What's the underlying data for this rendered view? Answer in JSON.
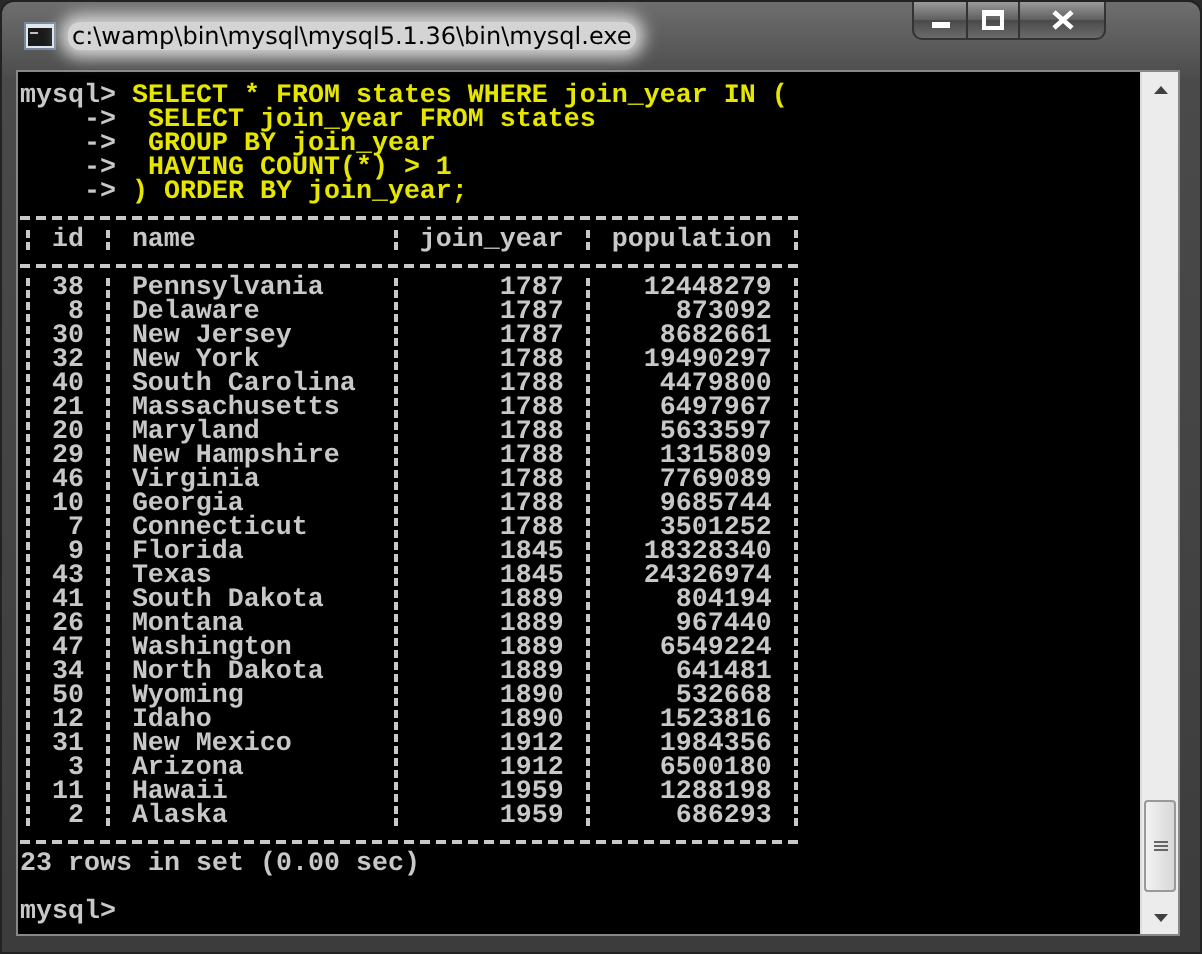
{
  "window": {
    "title": "c:\\wamp\\bin\\mysql\\mysql5.1.36\\bin\\mysql.exe"
  },
  "console": {
    "query": [
      {
        "prompt": "mysql>",
        "input": "SELECT * FROM states WHERE join_year IN ("
      },
      {
        "prompt": "->",
        "input": " SELECT join_year FROM states"
      },
      {
        "prompt": "->",
        "input": " GROUP BY join_year"
      },
      {
        "prompt": "->",
        "input": " HAVING COUNT(*) > 1"
      },
      {
        "prompt": "->",
        "input": ") ORDER BY join_year;"
      }
    ],
    "table": {
      "columns": [
        "id",
        "name",
        "join_year",
        "population"
      ],
      "rows": [
        [
          "38",
          "Pennsylvania",
          "1787",
          "12448279"
        ],
        [
          "8",
          "Delaware",
          "1787",
          "873092"
        ],
        [
          "30",
          "New Jersey",
          "1787",
          "8682661"
        ],
        [
          "32",
          "New York",
          "1788",
          "19490297"
        ],
        [
          "40",
          "South Carolina",
          "1788",
          "4479800"
        ],
        [
          "21",
          "Massachusetts",
          "1788",
          "6497967"
        ],
        [
          "20",
          "Maryland",
          "1788",
          "5633597"
        ],
        [
          "29",
          "New Hampshire",
          "1788",
          "1315809"
        ],
        [
          "46",
          "Virginia",
          "1788",
          "7769089"
        ],
        [
          "10",
          "Georgia",
          "1788",
          "9685744"
        ],
        [
          "7",
          "Connecticut",
          "1788",
          "3501252"
        ],
        [
          "9",
          "Florida",
          "1845",
          "18328340"
        ],
        [
          "43",
          "Texas",
          "1845",
          "24326974"
        ],
        [
          "41",
          "South Dakota",
          "1889",
          "804194"
        ],
        [
          "26",
          "Montana",
          "1889",
          "967440"
        ],
        [
          "47",
          "Washington",
          "1889",
          "6549224"
        ],
        [
          "34",
          "North Dakota",
          "1889",
          "641481"
        ],
        [
          "50",
          "Wyoming",
          "1890",
          "532668"
        ],
        [
          "12",
          "Idaho",
          "1890",
          "1523816"
        ],
        [
          "31",
          "New Mexico",
          "1912",
          "1984356"
        ],
        [
          "3",
          "Arizona",
          "1912",
          "6500180"
        ],
        [
          "11",
          "Hawaii",
          "1959",
          "1288198"
        ],
        [
          "2",
          "Alaska",
          "1959",
          "686293"
        ]
      ]
    },
    "status": "23 rows in set (0.00 sec)",
    "prompt": "mysql>"
  }
}
